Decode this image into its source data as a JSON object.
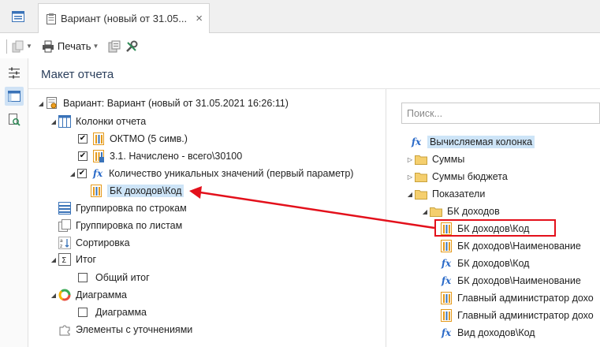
{
  "tab": {
    "title": "Вариант (новый от 31.05...",
    "close": "×"
  },
  "toolbar": {
    "print_label": "Печать"
  },
  "panel": {
    "title": "Макет отчета"
  },
  "left_tree": {
    "root": "Вариант: Вариант (новый от 31.05.2021 16:26:11)",
    "columns": "Колонки отчета",
    "col1": "ОКТМО (5 симв.)",
    "col2": "3.1. Начислено - всего\\30100",
    "col3": "Количество уникальных значений (первый параметр)",
    "col3_child": "БК доходов\\Код",
    "group_rows": "Группировка по строкам",
    "group_sheets": "Группировка по листам",
    "sort": "Сортировка",
    "total": "Итог",
    "total_child": "Общий итог",
    "chart": "Диаграмма",
    "chart_child": "Диаграмма",
    "refine": "Элементы с уточнениями"
  },
  "search": {
    "placeholder": "Поиск..."
  },
  "right_tree": {
    "calc": "Вычисляемая колонка",
    "sums": "Суммы",
    "budget_sums": "Суммы бюджета",
    "indicators": "Показатели",
    "bk": "БК доходов",
    "items": [
      "БК доходов\\Код",
      "БК доходов\\Наименование",
      "БК доходов\\Код",
      "БК доходов\\Наименование",
      "Главный администратор дохо",
      "Главный администратор дохо",
      "Вид доходов\\Код"
    ]
  }
}
